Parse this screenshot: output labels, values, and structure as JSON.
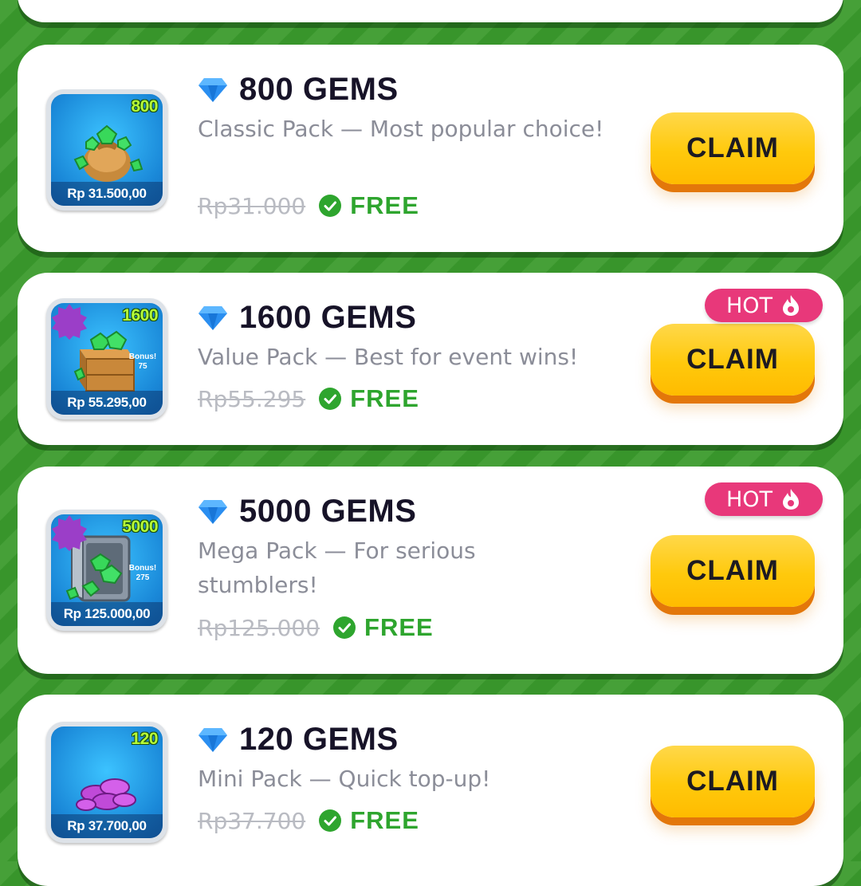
{
  "offers": [
    {
      "gem_count": "800",
      "title": "800 GEMS",
      "description": "Classic Pack — Most popular choice!",
      "thumbnail_price": "Rp 31.500,00",
      "old_price": "Rp31.000",
      "free_label": "FREE",
      "claim_label": "CLAIM",
      "hot_label": null,
      "bonus": null
    },
    {
      "gem_count": "1600",
      "title": "1600 GEMS",
      "description": "Value Pack — Best for event wins!",
      "thumbnail_price": "Rp 55.295,00",
      "old_price": "Rp55.295",
      "free_label": "FREE",
      "claim_label": "CLAIM",
      "hot_label": "HOT",
      "bonus": {
        "label": "Bonus!",
        "amount": "75"
      }
    },
    {
      "gem_count": "5000",
      "title": "5000 GEMS",
      "description": "Mega Pack — For serious stumblers!",
      "thumbnail_price": "Rp 125.000,00",
      "old_price": "Rp125.000",
      "free_label": "FREE",
      "claim_label": "CLAIM",
      "hot_label": "HOT",
      "bonus": {
        "label": "Bonus!",
        "amount": "275"
      }
    },
    {
      "gem_count": "120",
      "title": "120 GEMS",
      "description": "Mini Pack — Quick top-up!",
      "thumbnail_price": "Rp 37.700,00",
      "old_price": "Rp37.700",
      "free_label": "FREE",
      "claim_label": "CLAIM",
      "hot_label": null,
      "bonus": null
    }
  ],
  "colors": {
    "background": "#3a9a2c",
    "card": "#ffffff",
    "claim_button": "#ffc90c",
    "claim_shadow": "#e3770a",
    "hot_badge": "#e8387a",
    "free_text": "#2ea52e",
    "gem_icon": "#2a8ef0"
  },
  "icons": {
    "gem": "diamond-icon",
    "check": "check-circle-icon",
    "flame": "flame-icon"
  }
}
